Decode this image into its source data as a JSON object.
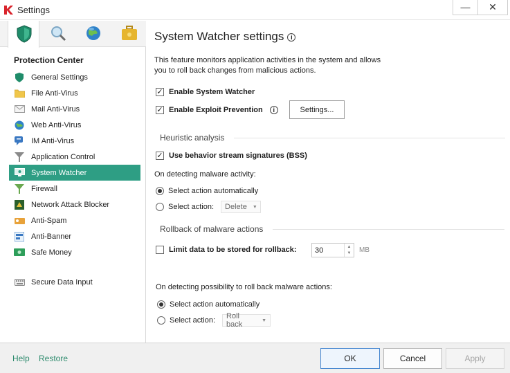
{
  "window": {
    "title": "Settings",
    "minimize": "—",
    "close": "✕"
  },
  "sidebar": {
    "tabs": [
      {
        "icon": "shield-icon",
        "active": true
      },
      {
        "icon": "magnifier-icon",
        "active": false
      },
      {
        "icon": "globe-icon",
        "active": false
      },
      {
        "icon": "briefcase-icon",
        "active": false
      }
    ],
    "section_title": "Protection Center",
    "items": [
      {
        "label": "General Settings",
        "icon": "shield-icon"
      },
      {
        "label": "File Anti-Virus",
        "icon": "folder-icon"
      },
      {
        "label": "Mail Anti-Virus",
        "icon": "envelope-icon"
      },
      {
        "label": "Web Anti-Virus",
        "icon": "globe-icon"
      },
      {
        "label": "IM Anti-Virus",
        "icon": "chat-icon"
      },
      {
        "label": "Application Control",
        "icon": "funnel-icon"
      },
      {
        "label": "System Watcher",
        "icon": "monitor-icon",
        "active": true
      },
      {
        "label": "Firewall",
        "icon": "firewall-icon"
      },
      {
        "label": "Network Attack Blocker",
        "icon": "network-icon"
      },
      {
        "label": "Anti-Spam",
        "icon": "spam-icon"
      },
      {
        "label": "Anti-Banner",
        "icon": "banner-icon"
      },
      {
        "label": "Safe Money",
        "icon": "money-icon"
      }
    ],
    "extra_item": {
      "label": "Secure Data Input",
      "icon": "keyboard-icon"
    }
  },
  "main": {
    "title": "System Watcher settings",
    "description": "This feature monitors application activities in the system and allows you to roll back changes from malicious actions.",
    "enable_system_watcher": {
      "label": "Enable System Watcher",
      "checked": true
    },
    "enable_exploit_prevention": {
      "label": "Enable Exploit Prevention",
      "checked": true
    },
    "settings_button": "Settings...",
    "heuristic_heading": "Heuristic analysis",
    "use_bss": {
      "label": "Use behavior stream signatures (BSS)",
      "checked": true
    },
    "detect_label": "On detecting malware activity:",
    "detect_auto": {
      "label": "Select action automatically",
      "selected": true
    },
    "detect_select": {
      "label": "Select action:",
      "selected": false,
      "value": "Delete"
    },
    "rollback_heading": "Rollback of malware actions",
    "limit_data": {
      "label": "Limit data to be stored for rollback:",
      "checked": false,
      "value": "30",
      "unit": "MB"
    },
    "rollback_label": "On detecting possibility to roll back malware actions:",
    "rollback_auto": {
      "label": "Select action automatically",
      "selected": true
    },
    "rollback_select": {
      "label": "Select action:",
      "selected": false,
      "value": "Roll back"
    }
  },
  "footer": {
    "help": "Help",
    "restore": "Restore",
    "ok": "OK",
    "cancel": "Cancel",
    "apply": "Apply"
  },
  "colors": {
    "accent": "#2e9e84",
    "link": "#2c8a6c",
    "ok_border": "#4b8ad1"
  }
}
